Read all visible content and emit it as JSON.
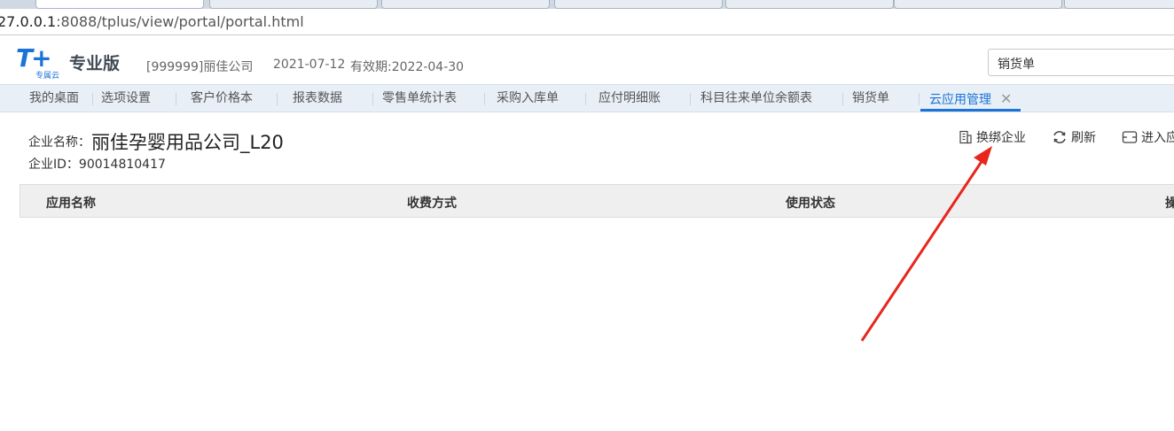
{
  "browser": {
    "url_prefix": "27.0.0.1",
    "url_rest": ":8088/tplus/view/portal/portal.html"
  },
  "header": {
    "logo_mark": "T+",
    "logo_sub": "专属云",
    "edition": "专业版",
    "company": "[999999]丽佳公司",
    "date": "2021-07-12",
    "valid_until": "有效期:2022-04-30",
    "search_value": "销货单"
  },
  "tabs": [
    {
      "label": "我的桌面"
    },
    {
      "label": "选项设置"
    },
    {
      "label": "客户价格本"
    },
    {
      "label": "报表数据"
    },
    {
      "label": "零售单统计表"
    },
    {
      "label": "采购入库单"
    },
    {
      "label": "应付明细账"
    },
    {
      "label": "科目往来单位余额表"
    },
    {
      "label": "销货单"
    },
    {
      "label": "云应用管理",
      "active": true,
      "close": "✕"
    }
  ],
  "content": {
    "company_label": "企业名称：",
    "company_name": "丽佳孕婴用品公司_L20",
    "company_id": "企业ID：90014810417",
    "actions": {
      "rebind": "换绑企业",
      "refresh": "刷新",
      "enter": "进入应"
    },
    "columns": [
      "应用名称",
      "收费方式",
      "使用状态",
      "操"
    ]
  },
  "colors": {
    "accent": "#1b73d8",
    "tabbar_bg": "#e8eff7",
    "annotation_arrow": "#e8261c"
  }
}
